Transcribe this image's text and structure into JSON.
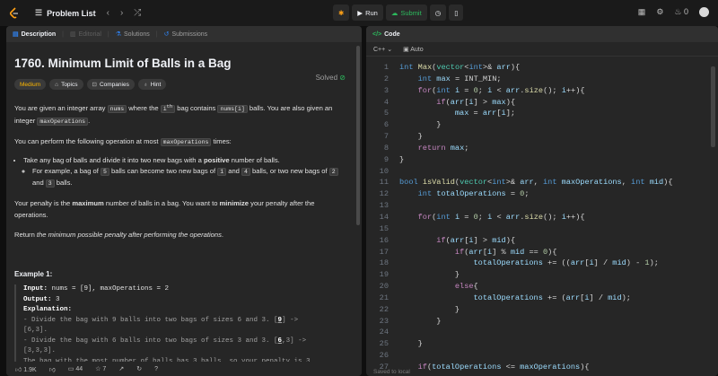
{
  "header": {
    "problem_list": "Problem List",
    "run": "Run",
    "submit": "Submit",
    "coins": "0"
  },
  "left_tabs": [
    "Description",
    "Editorial",
    "Solutions",
    "Submissions"
  ],
  "problem": {
    "title": "1760. Minimum Limit of Balls in a Bag",
    "status": "Solved",
    "chips": [
      "Medium",
      "Topics",
      "Companies",
      "Hint"
    ]
  },
  "footer": {
    "likes": "1.9K",
    "comments": "44",
    "stars": "7"
  },
  "code_panel": {
    "tab": "Code",
    "language": "C++",
    "mode": "Auto",
    "saved": "Saved to local"
  }
}
